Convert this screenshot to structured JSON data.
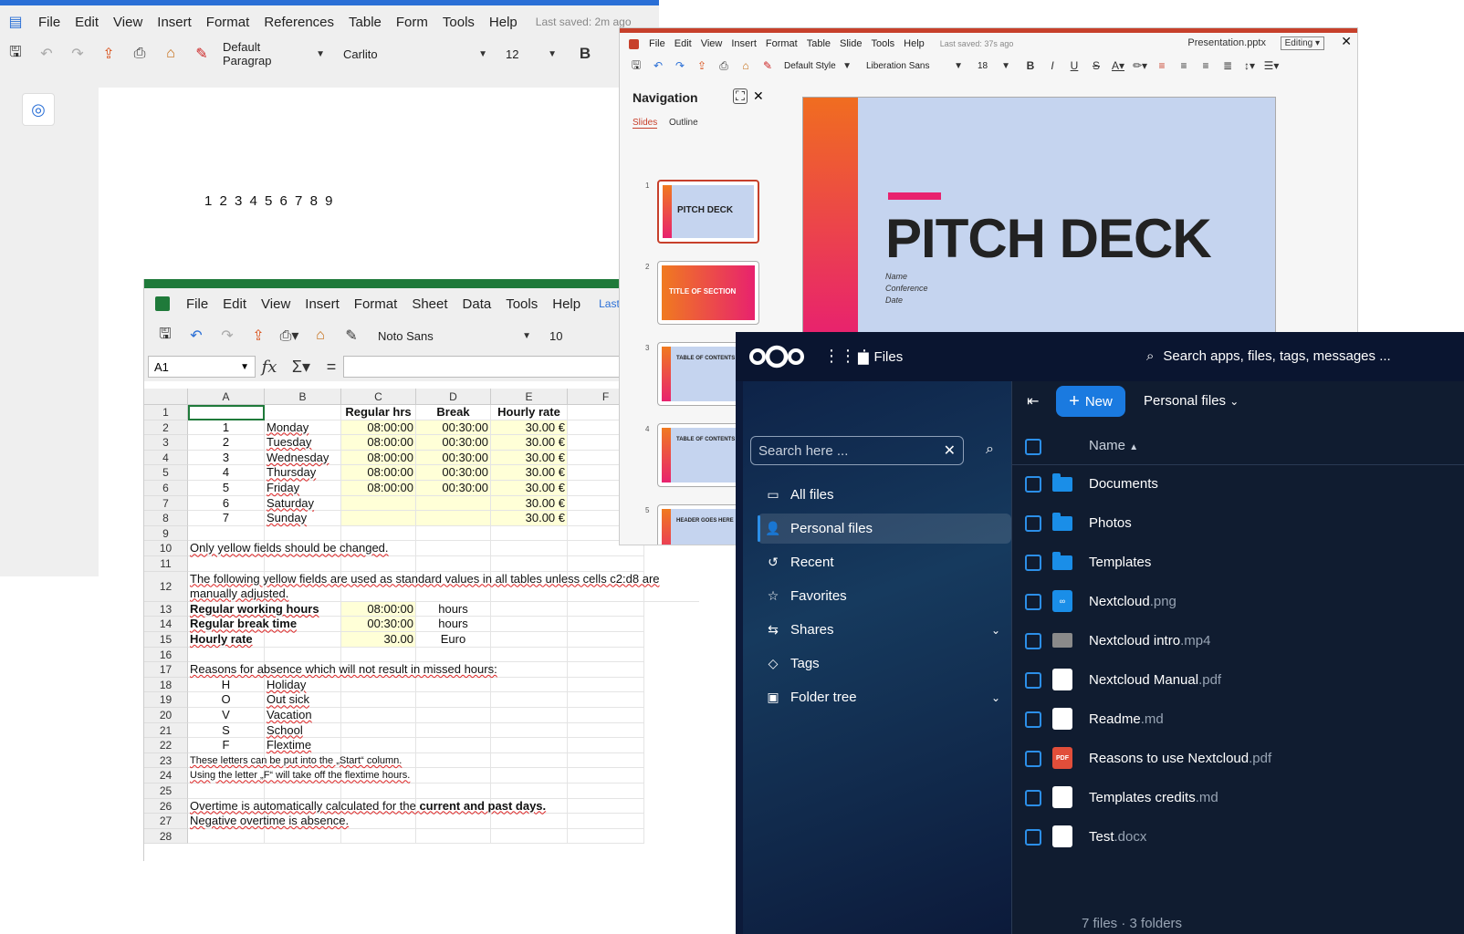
{
  "writer": {
    "menu": [
      "File",
      "Edit",
      "View",
      "Insert",
      "Format",
      "References",
      "Table",
      "Form",
      "Tools",
      "Help"
    ],
    "last_saved": "Last saved: 2m ago",
    "para_style": "Default Paragrap",
    "font": "Carlito",
    "size": "12",
    "bold": "B",
    "doc_text": "1 2 3 4 5 6 7 8 9"
  },
  "calc": {
    "menu": [
      "File",
      "Edit",
      "View",
      "Insert",
      "Format",
      "Sheet",
      "Data",
      "Tools",
      "Help"
    ],
    "last_saved": "Last",
    "font": "Noto Sans",
    "size": "10",
    "cell_ref": "A1",
    "fx": "fx",
    "sigma": "Σ",
    "equals": "=",
    "columns": [
      "A",
      "B",
      "C",
      "D",
      "E",
      "F"
    ],
    "rows": [
      "1",
      "2",
      "3",
      "4",
      "5",
      "6",
      "7",
      "8",
      "9",
      "10",
      "11",
      "12",
      "13",
      "14",
      "15",
      "16",
      "17",
      "18",
      "19",
      "20",
      "21",
      "22",
      "23",
      "24",
      "25",
      "26",
      "27",
      "28"
    ],
    "headers": [
      "Regular hrs",
      "Break",
      "Hourly rate"
    ],
    "days": [
      {
        "n": "1",
        "day": "Monday",
        "hrs": "08:00:00",
        "brk": "00:30:00",
        "rate": "30.00 €"
      },
      {
        "n": "2",
        "day": "Tuesday",
        "hrs": "08:00:00",
        "brk": "00:30:00",
        "rate": "30.00 €"
      },
      {
        "n": "3",
        "day": "Wednesday",
        "hrs": "08:00:00",
        "brk": "00:30:00",
        "rate": "30.00 €"
      },
      {
        "n": "4",
        "day": "Thursday",
        "hrs": "08:00:00",
        "brk": "00:30:00",
        "rate": "30.00 €"
      },
      {
        "n": "5",
        "day": "Friday",
        "hrs": "08:00:00",
        "brk": "00:30:00",
        "rate": "30.00 €"
      },
      {
        "n": "6",
        "day": "Saturday",
        "hrs": "",
        "brk": "",
        "rate": "30.00 €"
      },
      {
        "n": "7",
        "day": "Sunday",
        "hrs": "",
        "brk": "",
        "rate": "30.00 €"
      }
    ],
    "note_yellow": "Only yellow fields should be changed.",
    "note_standard_1": "The following yellow fields are used as standard values in all tables unless cells c2:d8 are",
    "note_standard_2": "manually adjusted.",
    "std": [
      {
        "label": "Regular working hours",
        "value": "08:00:00",
        "unit": "hours"
      },
      {
        "label": "Regular break time",
        "value": "00:30:00",
        "unit": "hours"
      },
      {
        "label": "Hourly rate",
        "value": "30.00",
        "unit": "Euro"
      }
    ],
    "absence_title": "Reasons for absence which will not result in missed hours:",
    "absence": [
      {
        "code": "H",
        "label": "Holiday"
      },
      {
        "code": "O",
        "label": "Out sick"
      },
      {
        "code": "V",
        "label": "Vacation"
      },
      {
        "code": "S",
        "label": "School"
      },
      {
        "code": "F",
        "label": "Flextime"
      }
    ],
    "letters_note_1": "These letters can be put into the „Start“ column.",
    "letters_note_2": "Using the letter „F“ will take off the flextime hours.",
    "overtime_1": "Overtime is automatically calculated for the ",
    "overtime_1b": "current and past days.",
    "overtime_2": "Negative overtime is absence."
  },
  "impress": {
    "menu": [
      "File",
      "Edit",
      "View",
      "Insert",
      "Format",
      "Table",
      "Slide",
      "Tools",
      "Help"
    ],
    "last_saved": "Last saved: 37s ago",
    "filename": "Presentation.pptx",
    "mode": "Editing",
    "close": "✕",
    "style": "Default Style",
    "font": "Liberation Sans",
    "size": "18",
    "nav_title": "Navigation",
    "tab_slides": "Slides",
    "tab_outline": "Outline",
    "thumbs": [
      {
        "num": "1",
        "title": "PITCH DECK"
      },
      {
        "num": "2",
        "title": "TITLE OF SECTION"
      },
      {
        "num": "3",
        "title": "TABLE OF CONTENTS"
      },
      {
        "num": "4",
        "title": "TABLE OF CONTENTS"
      },
      {
        "num": "5",
        "title": "HEADER GOES HERE"
      }
    ],
    "slide_title": "PITCH DECK",
    "slide_sub": [
      "Name",
      "Conference",
      "Date"
    ]
  },
  "nextcloud": {
    "app": "Files",
    "search": "Search apps, files, tags, messages ...",
    "sidebar_search": "Search here ...",
    "nav": [
      {
        "label": "All files",
        "icon": "folder-outline-icon"
      },
      {
        "label": "Personal files",
        "icon": "account-icon"
      },
      {
        "label": "Recent",
        "icon": "history-icon"
      },
      {
        "label": "Favorites",
        "icon": "star-icon"
      },
      {
        "label": "Shares",
        "icon": "share-icon"
      },
      {
        "label": "Tags",
        "icon": "tag-icon"
      },
      {
        "label": "Folder tree",
        "icon": "folder-tree-icon"
      }
    ],
    "new_label": "New",
    "breadcrumb": "Personal files",
    "name_col": "Name",
    "files": [
      {
        "name": "Documents",
        "ext": "",
        "type": "folder"
      },
      {
        "name": "Photos",
        "ext": "",
        "type": "folder"
      },
      {
        "name": "Templates",
        "ext": "",
        "type": "folder"
      },
      {
        "name": "Nextcloud",
        "ext": ".png",
        "type": "nc"
      },
      {
        "name": "Nextcloud intro",
        "ext": ".mp4",
        "type": "video"
      },
      {
        "name": "Nextcloud Manual",
        "ext": ".pdf",
        "type": "page"
      },
      {
        "name": "Readme",
        "ext": ".md",
        "type": "page"
      },
      {
        "name": "Reasons to use Nextcloud",
        "ext": ".pdf",
        "type": "pdf"
      },
      {
        "name": "Templates credits",
        "ext": ".md",
        "type": "page"
      },
      {
        "name": "Test",
        "ext": ".docx",
        "type": "page"
      }
    ],
    "pdf_badge": "PDF",
    "summary": "7 files · 3 folders",
    "colors": {
      "accent": "#1a7ae0",
      "bg": "#0c1a3a"
    }
  }
}
